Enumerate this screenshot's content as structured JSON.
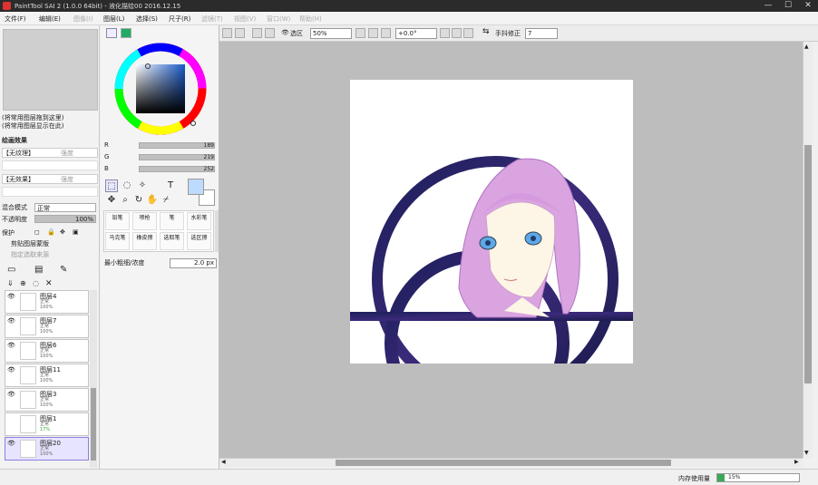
{
  "window": {
    "title": "PaintTool SAI 2 (1.0.0 64bit) - 液化描绘00  2016.12.15"
  },
  "menu": [
    {
      "label": "文件(F)",
      "dim": false
    },
    {
      "label": "编辑(E)",
      "dim": false
    },
    {
      "label": "图像(I)",
      "dim": true
    },
    {
      "label": "图层(L)",
      "dim": false
    },
    {
      "label": "选择(S)",
      "dim": false
    },
    {
      "label": "尺子(R)",
      "dim": false
    },
    {
      "label": "滤镜(T)",
      "dim": true
    },
    {
      "label": "视图(V)",
      "dim": true
    },
    {
      "label": "窗口(W)",
      "dim": true
    },
    {
      "label": "帮助(H)",
      "dim": true
    }
  ],
  "topbar": {
    "selection_label": "选区",
    "zoom": "50%",
    "rotation": "+0.0°",
    "stabilizer_label": "手抖修正",
    "stabilizer_value": "7"
  },
  "left": {
    "nav_hint_1": "(将常用图层拖到这里)",
    "nav_hint_2": "(将常用图层显示在此)",
    "effects_title": "绘画效果",
    "texture_label": "【无纹理】",
    "texture_mode": "强度",
    "effect_label": "【无效果】",
    "effect_mode": "强度",
    "blend_label": "混合模式",
    "blend_value": "正常",
    "opacity_label": "不透明度",
    "opacity_value": "100%",
    "protect_label": "保护",
    "clip_label": "剪贴图层蒙版",
    "ref_label": "指定选取来源",
    "layers": [
      {
        "name": "图层4",
        "mode": "正常",
        "opacity": "100%"
      },
      {
        "name": "图层7",
        "mode": "正常",
        "opacity": "100%"
      },
      {
        "name": "图层6",
        "mode": "正常",
        "opacity": "100%"
      },
      {
        "name": "图层11",
        "mode": "正常",
        "opacity": "100%"
      },
      {
        "name": "图层3",
        "mode": "正常",
        "opacity": "100%"
      },
      {
        "name": "图层1",
        "mode": "正常",
        "opacity": "17%"
      },
      {
        "name": "图层20",
        "mode": "正常",
        "opacity": "100%"
      }
    ]
  },
  "color": {
    "r_label": "R",
    "r_value": "189",
    "g_label": "G",
    "g_value": "219",
    "b_label": "B",
    "b_value": "252",
    "current": "#bddbfc",
    "text_tool": "T"
  },
  "brushes": [
    {
      "label": "铅笔"
    },
    {
      "label": "喷枪"
    },
    {
      "label": "笔"
    },
    {
      "label": "水彩笔"
    },
    {
      "label": "马克笔"
    },
    {
      "label": "橡皮擦"
    },
    {
      "label": "选取笔"
    },
    {
      "label": "选区擦"
    }
  ],
  "brush_size": {
    "label": "最小粗细/浓度",
    "value": "2.0 px"
  },
  "status": {
    "memory_label": "内存使用量",
    "memory_value": "15%"
  }
}
